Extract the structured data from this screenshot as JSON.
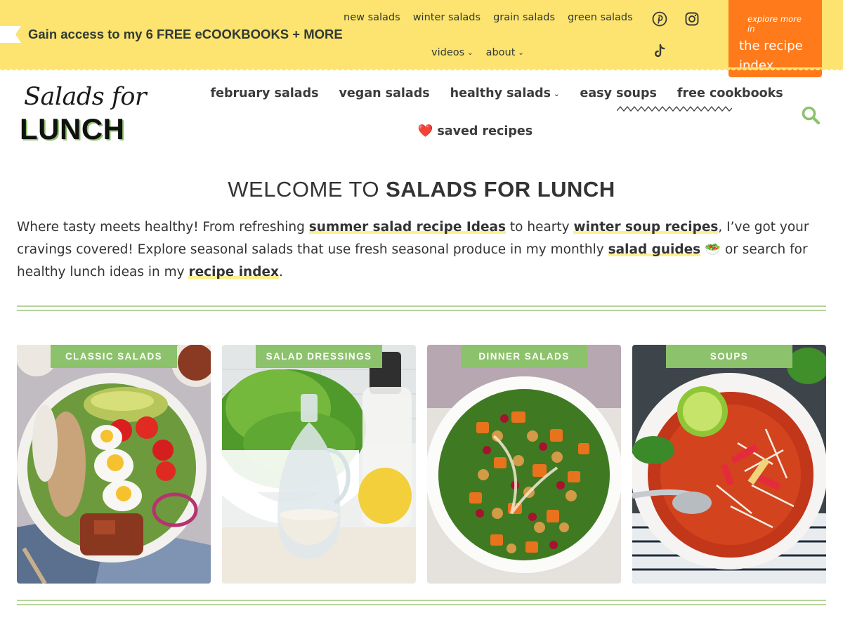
{
  "topbar": {
    "promo_text": "Gain access to my 6 FREE eCOOKBOOKS + MORE",
    "links_row1": [
      "new salads",
      "winter salads",
      "grain salads",
      "green salads"
    ],
    "links_row2": [
      {
        "label": "videos",
        "has_dropdown": true
      },
      {
        "label": "about",
        "has_dropdown": true
      }
    ],
    "social_icons": [
      "pinterest-icon",
      "instagram-icon",
      "tiktok-icon"
    ],
    "recipe_index_small": "explore more in",
    "recipe_index_big": "the recipe index",
    "background_color": "#fde36f",
    "button_color": "#ff7a1a"
  },
  "header": {
    "logo_script": "Salads for",
    "logo_block": "LUNCH",
    "nav_row1": [
      {
        "label": "february salads",
        "has_dropdown": false
      },
      {
        "label": "vegan salads",
        "has_dropdown": false
      },
      {
        "label": "healthy salads",
        "has_dropdown": true
      },
      {
        "label": "easy soups",
        "has_dropdown": false
      },
      {
        "label": "free cookbooks",
        "has_dropdown": false
      }
    ],
    "nav_row2": [
      {
        "label": "❤️ saved recipes",
        "has_dropdown": false
      }
    ],
    "accent_color": "#8cc26b"
  },
  "welcome": {
    "title_prefix": "WELCOME TO ",
    "title_strong": "SALADS FOR LUNCH",
    "intro_parts": {
      "p1": "Where tasty meets healthy! From refreshing ",
      "link1": "summer salad recipe Ideas",
      "p2": " to hearty ",
      "link2": "winter soup recipes",
      "p3": ", I’ve got your cravings covered! Explore seasonal salads that use fresh seasonal produce in my monthly ",
      "link3": "salad guides",
      "p4": " 🥗 or search for healthy lunch ideas in my ",
      "link4": "recipe index",
      "p5": "."
    }
  },
  "categories": [
    {
      "label": "CLASSIC SALADS"
    },
    {
      "label": "SALAD DRESSINGS"
    },
    {
      "label": "DINNER SALADS"
    },
    {
      "label": "SOUPS"
    }
  ]
}
